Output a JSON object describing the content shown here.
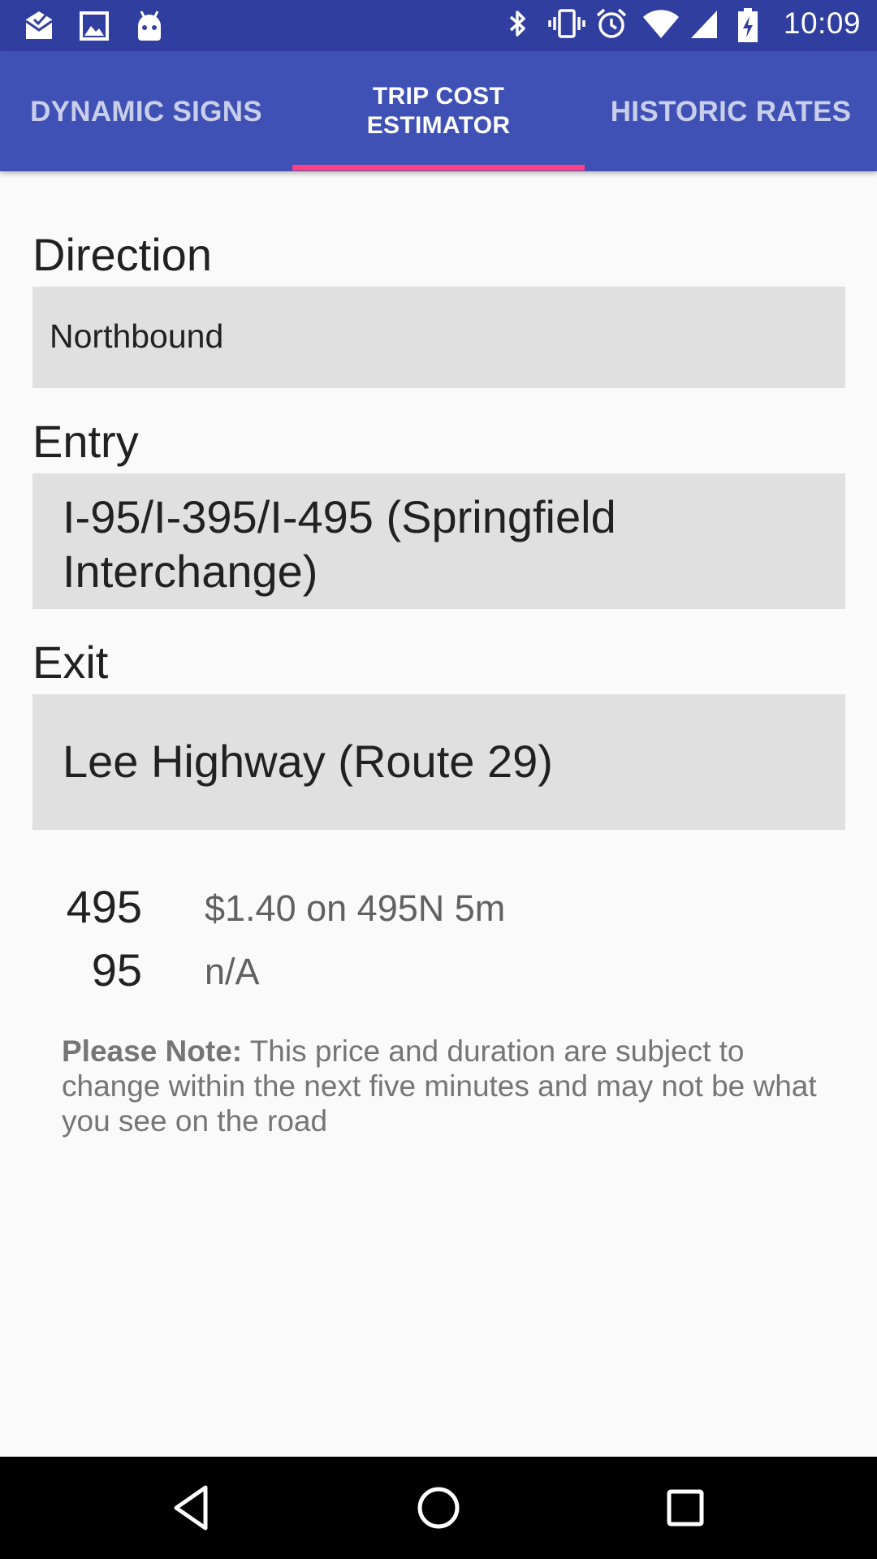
{
  "status_bar": {
    "time": "10:09",
    "left_icons": [
      "mail-icon",
      "image-icon",
      "android-icon"
    ],
    "right_icons": [
      "bluetooth-icon",
      "vibrate-icon",
      "alarm-icon",
      "wifi-icon",
      "signal-icon",
      "battery-charging-icon"
    ]
  },
  "colors": {
    "status_bar": "#303f9f",
    "primary": "#3f51b5",
    "accent": "#ff4081",
    "field_bg": "#e0e0e0"
  },
  "tabs": [
    {
      "label": "DYNAMIC SIGNS",
      "active": false
    },
    {
      "label_line1": "TRIP COST",
      "label_line2": "ESTIMATOR",
      "active": true
    },
    {
      "label": "HISTORIC RATES",
      "active": false
    }
  ],
  "form": {
    "direction_label": "Direction",
    "direction_value": "Northbound",
    "entry_label": "Entry",
    "entry_value": "I-95/I-395/I-495 (Springfield Interchange)",
    "exit_label": "Exit",
    "exit_value": "Lee Highway (Route 29)"
  },
  "results": [
    {
      "route": "495",
      "text": "$1.40 on 495N 5m"
    },
    {
      "route": "95",
      "text": "n/A"
    }
  ],
  "note": {
    "bold": "Please Note:",
    "text": " This price and duration are subject to change within the next five minutes and may not be what you see on the road"
  },
  "nav_icons": [
    "back-icon",
    "home-icon",
    "recents-icon"
  ]
}
